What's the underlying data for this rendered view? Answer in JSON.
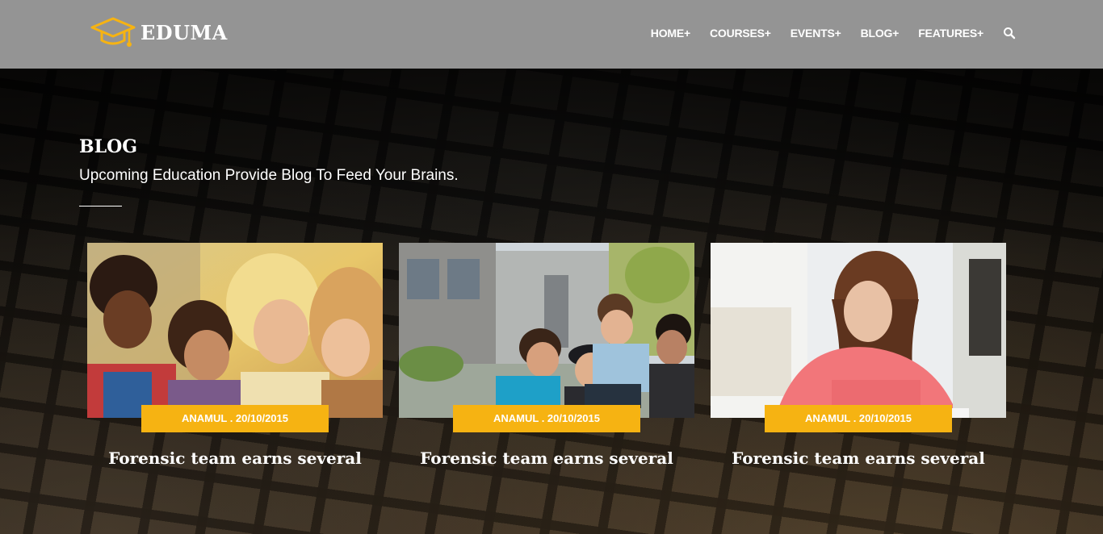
{
  "brand": {
    "name": "EDUMA",
    "accent": "#f6b312"
  },
  "nav": {
    "items": [
      {
        "label": "HOME+"
      },
      {
        "label": "COURSES+"
      },
      {
        "label": "EVENTS+"
      },
      {
        "label": "BLOG+"
      },
      {
        "label": "FEATURES+"
      }
    ],
    "search_icon": "search-icon"
  },
  "section": {
    "title": "BLOG",
    "subtitle": "Upcoming Education Provide Blog To Feed Your Brains."
  },
  "posts": [
    {
      "meta": "ANAMUL . 20/10/2015",
      "title": "Forensic team earns several"
    },
    {
      "meta": "ANAMUL . 20/10/2015",
      "title": "Forensic team earns several"
    },
    {
      "meta": "ANAMUL . 20/10/2015",
      "title": "Forensic team earns several"
    }
  ]
}
